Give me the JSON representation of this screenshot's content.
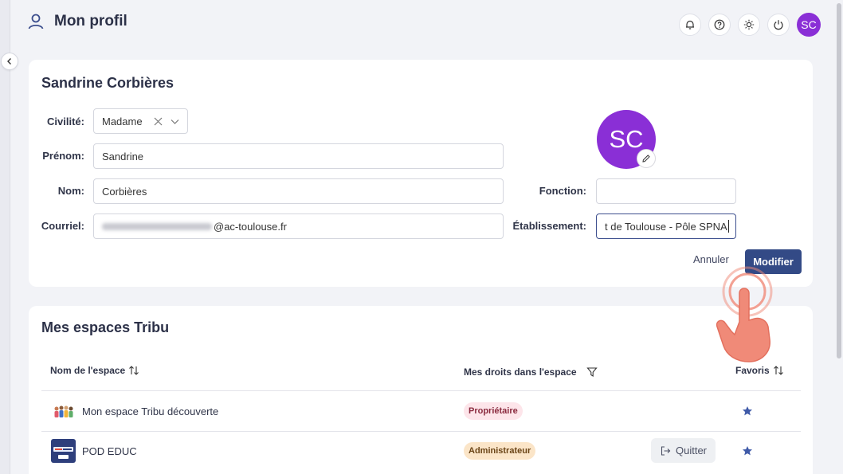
{
  "header": {
    "title": "Mon profil",
    "avatar_initials": "SC"
  },
  "profile_card": {
    "full_name": "Sandrine Corbières",
    "avatar_initials": "SC",
    "labels": {
      "civilite": "Civilité:",
      "prenom": "Prénom:",
      "nom": "Nom:",
      "courriel": "Courriel:",
      "fonction": "Fonction:",
      "etablissement": "Établissement:"
    },
    "values": {
      "civilite": "Madame",
      "prenom": "Sandrine",
      "nom": "Corbières",
      "courriel_domain": "@ac-toulouse.fr",
      "fonction": "",
      "etablissement": "t de Toulouse - Pôle SPNA"
    },
    "buttons": {
      "cancel": "Annuler",
      "submit": "Modifier"
    }
  },
  "spaces_card": {
    "title": "Mes espaces Tribu",
    "columns": {
      "name": "Nom de l'espace",
      "rights": "Mes droits dans l'espace",
      "favorites": "Favoris"
    },
    "rows": [
      {
        "name": "Mon espace Tribu découverte",
        "role": "Propriétaire",
        "favorite": true
      },
      {
        "name": "POD EDUC",
        "role": "Administrateur",
        "action": "Quitter",
        "favorite": true
      }
    ]
  },
  "colors": {
    "primary": "#334a86",
    "avatar": "#8a2fd6",
    "star": "#3f5aa8"
  }
}
